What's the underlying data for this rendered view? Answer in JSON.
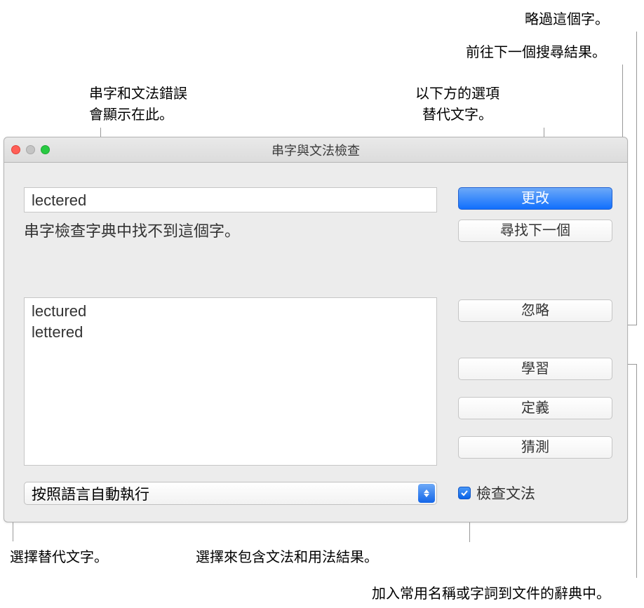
{
  "window": {
    "title": "串字與文法檢查"
  },
  "mistake": {
    "word": "lectered",
    "status": "串字檢查字典中找不到這個字。"
  },
  "suggestions": [
    "lectured",
    "lettered"
  ],
  "buttons": {
    "change": "更改",
    "findNext": "尋找下一個",
    "ignore": "忽略",
    "learn": "學習",
    "define": "定義",
    "guess": "猜測"
  },
  "dropdown": {
    "language": "按照語言自動執行"
  },
  "checkbox": {
    "grammar": "檢查文法"
  },
  "callouts": {
    "skip": "略過這個字。",
    "gotoNext": "前往下一個搜尋結果。",
    "replaceWithOption": "以下方的選項\n替代文字。",
    "errorsHere": "串字和文法錯誤\n會顯示在此。",
    "selectReplacement": "選擇替代文字。",
    "selectToInclude": "選擇來包含文法和用法結果。",
    "addToDict": "加入常用名稱或字詞到文件的辭典中。"
  }
}
